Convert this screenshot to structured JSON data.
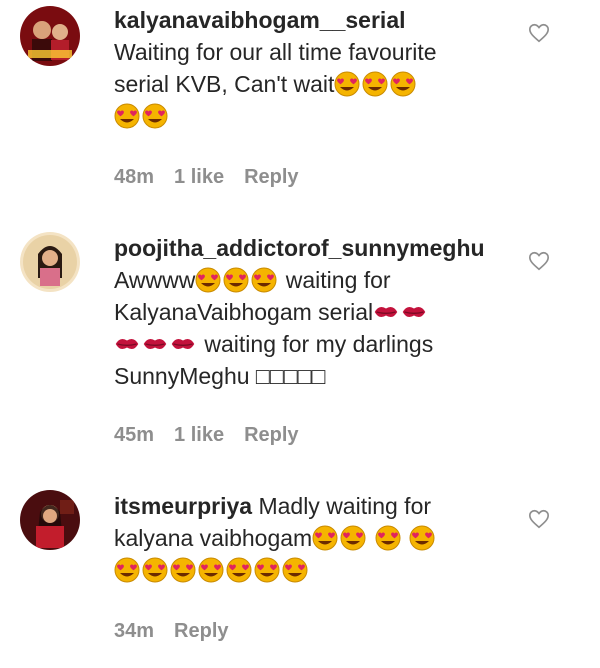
{
  "comments": [
    {
      "username": "kalyanavaibhogam__serial",
      "text_line1": "Waiting for our all time favourite",
      "text_line2": "serial KVB, Can't wait",
      "time": "48m",
      "likes": "1 like",
      "reply": "Reply"
    },
    {
      "username": "poojitha_addictorof_sunnymeghu",
      "text_line1": "Awwww",
      "text_line1b": "waiting for",
      "text_line2": "KalyanaVaibhogam serial",
      "text_line3": "waiting for my darlings",
      "text_line4": "SunnyMeghu □□□□□",
      "time": "45m",
      "likes": "1 like",
      "reply": "Reply"
    },
    {
      "username": "itsmeurpriya",
      "text_line1": "Madly waiting for",
      "text_line2": "kalyana vaibhogam",
      "time": "34m",
      "reply": "Reply"
    }
  ],
  "icons": {
    "like": "heart-outline-icon",
    "emoji": "smiling-face-with-heart-eyes",
    "kiss": "kiss-mark"
  },
  "colors": {
    "emoji_face": "#f5b400",
    "heart": "#e0245e",
    "meta": "#8e8e8e"
  }
}
